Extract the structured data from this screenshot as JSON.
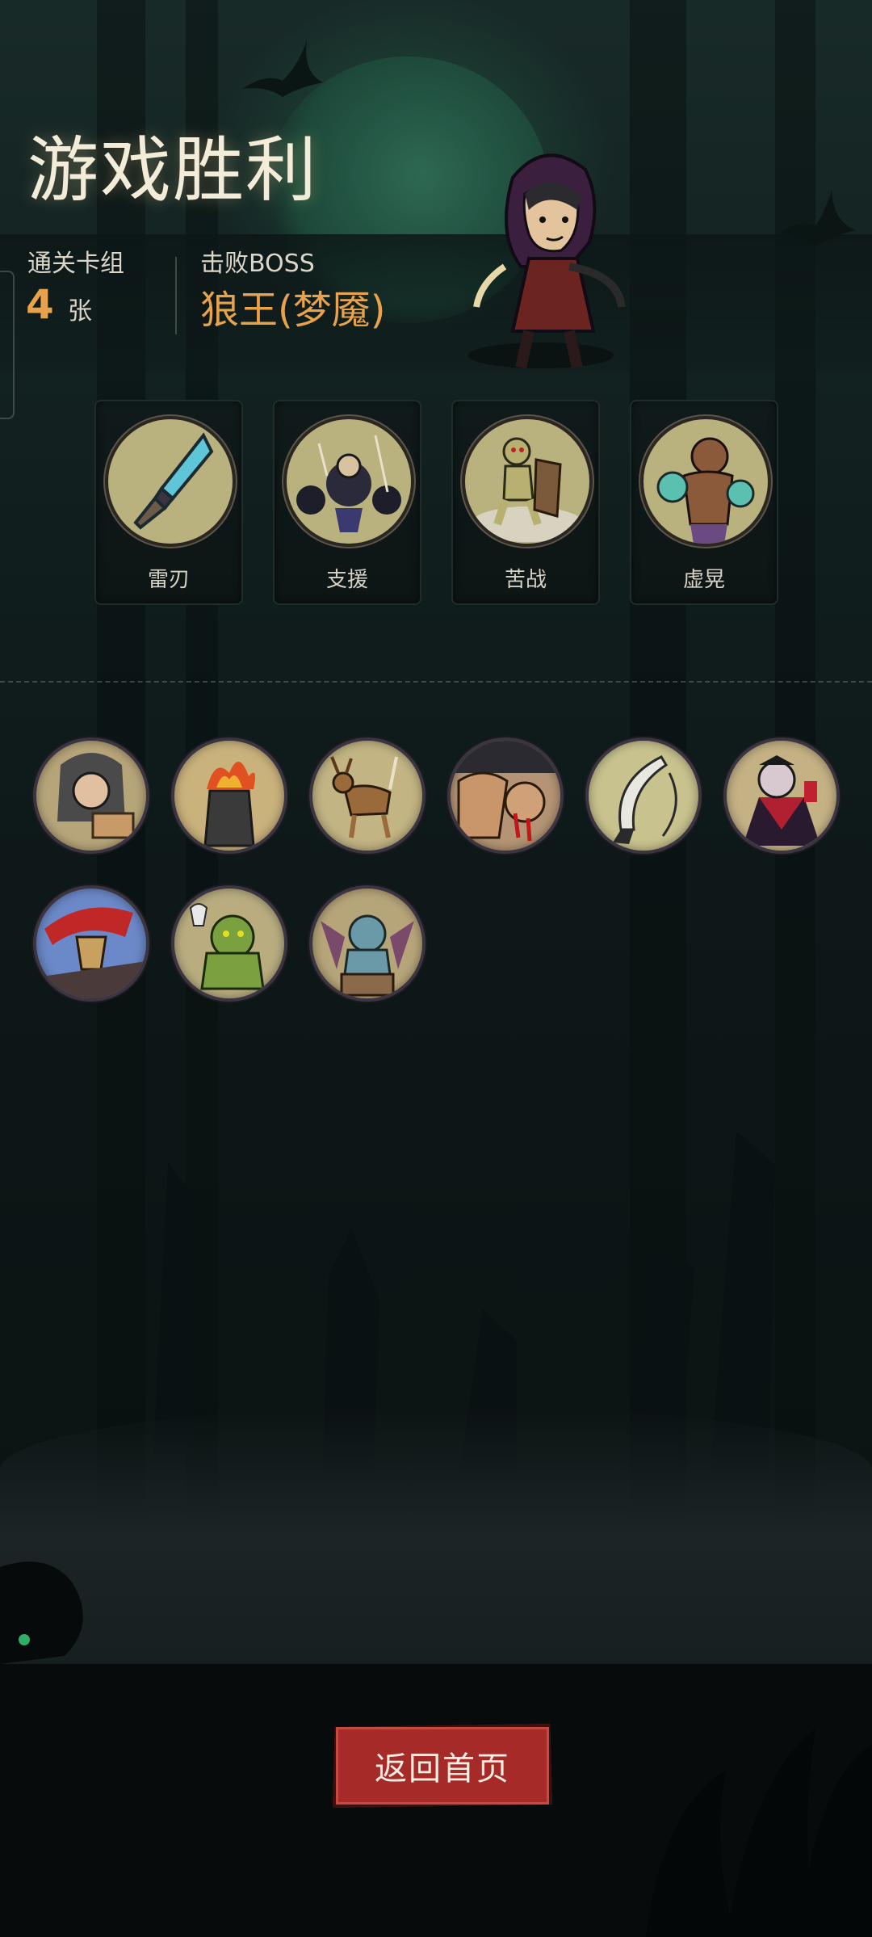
{
  "header": {
    "title": "游戏胜利",
    "deck_label": "通关卡组",
    "deck_count": "4",
    "deck_unit": "张",
    "boss_label": "击败BOSS",
    "boss_name": "狼王(梦魇)"
  },
  "cards": [
    {
      "label": "雷刃",
      "icon": "crystal-blade-icon"
    },
    {
      "label": "支援",
      "icon": "support-warriors-icon"
    },
    {
      "label": "苦战",
      "icon": "shield-fighter-icon"
    },
    {
      "label": "虚晃",
      "icon": "boxer-icon"
    }
  ],
  "relics": [
    {
      "icon": "hooded-merchant-icon",
      "color": "#b7a57a"
    },
    {
      "icon": "flaming-altar-icon",
      "color": "#c9b27c"
    },
    {
      "icon": "deer-icon",
      "color": "#c2b483"
    },
    {
      "icon": "bloody-fist-icon",
      "color": "#b49474"
    },
    {
      "icon": "crescent-blade-icon",
      "color": "#c8c28e"
    },
    {
      "icon": "vampire-icon",
      "color": "#c4b184"
    },
    {
      "icon": "red-cape-warrior-icon",
      "color": "#6b88c8"
    },
    {
      "icon": "green-ogre-icon",
      "color": "#b9ad80"
    },
    {
      "icon": "gargoyle-icon",
      "color": "#b7a57a"
    }
  ],
  "button": {
    "return_label": "返回首页"
  },
  "colors": {
    "accent_orange": "#e7a24b",
    "button_red": "#a52a28"
  }
}
